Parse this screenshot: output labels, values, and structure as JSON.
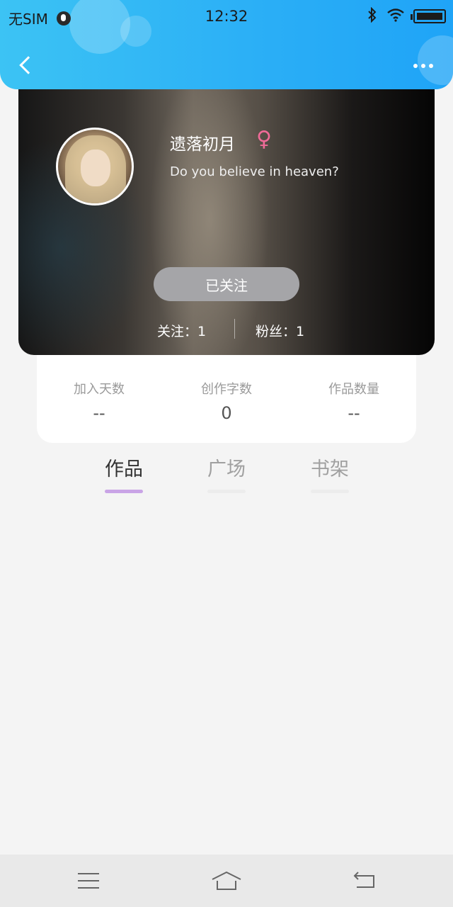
{
  "status_bar": {
    "carrier": "无SIM",
    "time": "12:32"
  },
  "profile": {
    "nickname": "遗落初月",
    "gender_symbol": "♀",
    "bio": "Do you believe in heaven?",
    "follow_button_label": "已关注",
    "following_text": "关注：1",
    "fans_text": "粉丝：1"
  },
  "stats": [
    {
      "label": "加入天数",
      "value": "--"
    },
    {
      "label": "创作字数",
      "value": "0"
    },
    {
      "label": "作品数量",
      "value": "--"
    }
  ],
  "tabs": [
    {
      "label": "作品",
      "active": true
    },
    {
      "label": "广场",
      "active": false
    },
    {
      "label": "书架",
      "active": false
    }
  ],
  "colors": {
    "header_gradient_start": "#3cc3f4",
    "header_gradient_end": "#1fa4f7",
    "gender_pink": "#f06b98",
    "active_tab_underline": "#c9a4e6",
    "follow_button": "#a5a5a8"
  },
  "icons": {
    "back": "chevron-left-icon",
    "more": "more-dots-icon",
    "gender": "female-icon",
    "nav_menu": "menu-icon",
    "nav_home": "home-icon",
    "nav_back": "back-icon"
  }
}
